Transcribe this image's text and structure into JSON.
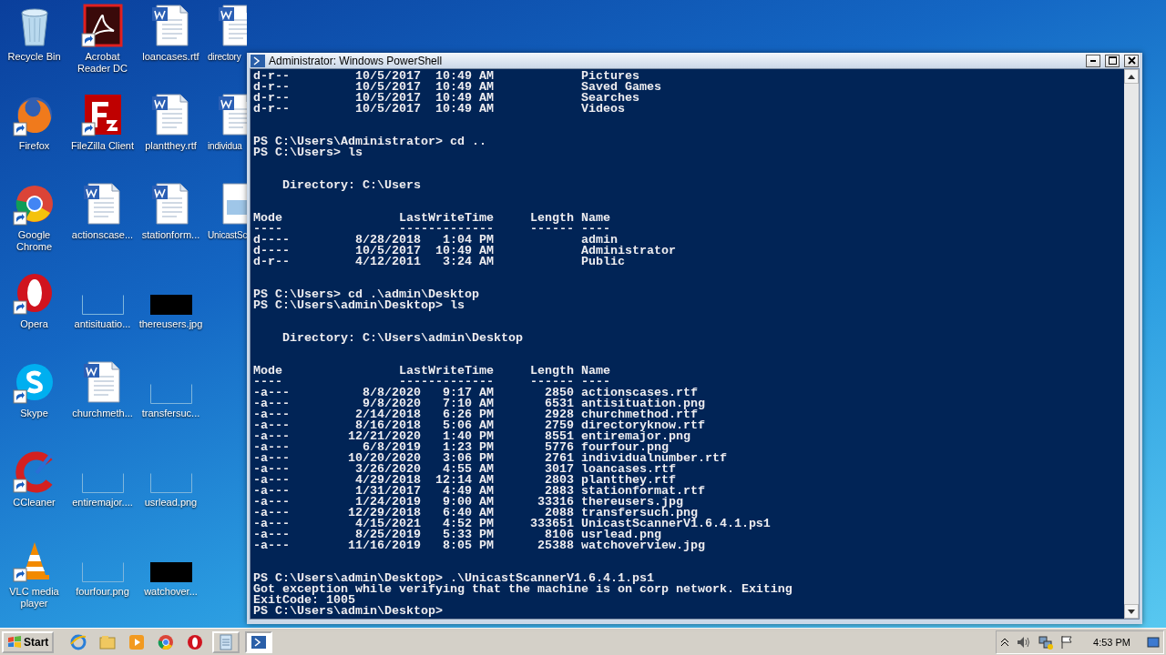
{
  "desktop_icons": [
    {
      "label": "Recycle Bin",
      "kind": "recycle",
      "shortcut": false
    },
    {
      "label": "Firefox",
      "kind": "firefox",
      "shortcut": true
    },
    {
      "label": "Google Chrome",
      "kind": "chrome",
      "shortcut": true
    },
    {
      "label": "Opera",
      "kind": "opera",
      "shortcut": true
    },
    {
      "label": "Skype",
      "kind": "skype",
      "shortcut": true
    },
    {
      "label": "CCleaner",
      "kind": "ccleaner",
      "shortcut": true
    },
    {
      "label": "VLC media player",
      "kind": "vlc",
      "shortcut": true
    },
    {
      "label": "Acrobat Reader DC",
      "kind": "acrobat",
      "shortcut": true
    },
    {
      "label": "FileZilla Client",
      "kind": "filezilla",
      "shortcut": true
    },
    {
      "label": "actionscase...",
      "kind": "document",
      "shortcut": false
    },
    {
      "label": "antisituatio...",
      "kind": "image-blank",
      "shortcut": false
    },
    {
      "label": "churchmeth...",
      "kind": "document",
      "shortcut": false
    },
    {
      "label": "entiremajor....",
      "kind": "image-blank",
      "shortcut": false
    },
    {
      "label": "fourfour.png",
      "kind": "image-blank",
      "shortcut": false
    },
    {
      "label": "loancases.rtf",
      "kind": "document",
      "shortcut": false
    },
    {
      "label": "plantthey.rtf",
      "kind": "document",
      "shortcut": false
    },
    {
      "label": "stationform...",
      "kind": "document",
      "shortcut": false
    },
    {
      "label": "thereusers.jpg",
      "kind": "image-dark",
      "shortcut": false
    },
    {
      "label": "transfersuc...",
      "kind": "image-blank",
      "shortcut": false
    },
    {
      "label": "usrlead.png",
      "kind": "image-blank",
      "shortcut": false
    },
    {
      "label": "watchover...",
      "kind": "image-dark",
      "shortcut": false
    },
    {
      "label": "directory",
      "kind": "document",
      "shortcut": false
    },
    {
      "label": "individua",
      "kind": "document",
      "shortcut": false
    },
    {
      "label": "UnicastSc",
      "kind": "script",
      "shortcut": false
    }
  ],
  "window": {
    "title": "Administrator: Windows PowerShell",
    "console_lines": [
      {
        "kind": "text",
        "text": "d-r--         10/5/2017  10:49 AM            Pictures"
      },
      {
        "kind": "text",
        "text": "d-r--         10/5/2017  10:49 AM            Saved Games"
      },
      {
        "kind": "text",
        "text": "d-r--         10/5/2017  10:49 AM            Searches"
      },
      {
        "kind": "text",
        "text": "d-r--         10/5/2017  10:49 AM            Videos"
      },
      {
        "kind": "blank"
      },
      {
        "kind": "blank"
      },
      {
        "kind": "text",
        "text": "PS C:\\Users\\Administrator> cd .."
      },
      {
        "kind": "text",
        "text": "PS C:\\Users> ls"
      },
      {
        "kind": "blank"
      },
      {
        "kind": "blank"
      },
      {
        "kind": "text",
        "text": "    Directory: C:\\Users"
      },
      {
        "kind": "blank"
      },
      {
        "kind": "blank"
      },
      {
        "kind": "text",
        "text": "Mode                LastWriteTime     Length Name"
      },
      {
        "kind": "text",
        "text": "----                -------------     ------ ----"
      },
      {
        "kind": "text",
        "text": "d----         8/28/2018   1:04 PM            admin"
      },
      {
        "kind": "text",
        "text": "d----         10/5/2017  10:49 AM            Administrator"
      },
      {
        "kind": "text",
        "text": "d-r--         4/12/2011   3:24 AM            Public"
      },
      {
        "kind": "blank"
      },
      {
        "kind": "blank"
      },
      {
        "kind": "text",
        "text": "PS C:\\Users> cd .\\admin\\Desktop"
      },
      {
        "kind": "text",
        "text": "PS C:\\Users\\admin\\Desktop> ls"
      },
      {
        "kind": "blank"
      },
      {
        "kind": "blank"
      },
      {
        "kind": "text",
        "text": "    Directory: C:\\Users\\admin\\Desktop"
      },
      {
        "kind": "blank"
      },
      {
        "kind": "blank"
      },
      {
        "kind": "text",
        "text": "Mode                LastWriteTime     Length Name"
      },
      {
        "kind": "text",
        "text": "----                -------------     ------ ----"
      },
      {
        "kind": "text",
        "text": "-a---          8/8/2020   9:17 AM       2850 actionscases.rtf"
      },
      {
        "kind": "text",
        "text": "-a---          9/8/2020   7:10 AM       6531 antisituation.png"
      },
      {
        "kind": "text",
        "text": "-a---         2/14/2018   6:26 PM       2928 churchmethod.rtf"
      },
      {
        "kind": "text",
        "text": "-a---         8/16/2018   5:06 AM       2759 directoryknow.rtf"
      },
      {
        "kind": "text",
        "text": "-a---        12/21/2020   1:40 PM       8551 entiremajor.png"
      },
      {
        "kind": "text",
        "text": "-a---          6/8/2019   1:23 PM       5776 fourfour.png"
      },
      {
        "kind": "text",
        "text": "-a---        10/20/2020   3:06 PM       2761 individualnumber.rtf"
      },
      {
        "kind": "text",
        "text": "-a---         3/26/2020   4:55 AM       3017 loancases.rtf"
      },
      {
        "kind": "text",
        "text": "-a---         4/29/2018  12:14 AM       2803 plantthey.rtf"
      },
      {
        "kind": "text",
        "text": "-a---         1/31/2017   4:49 AM       2883 stationformat.rtf"
      },
      {
        "kind": "text",
        "text": "-a---         1/24/2019   9:00 AM      33316 thereusers.jpg"
      },
      {
        "kind": "text",
        "text": "-a---        12/29/2018   6:40 AM       2088 transfersuch.png"
      },
      {
        "kind": "text",
        "text": "-a---         4/15/2021   4:52 PM     333651 UnicastScannerV1.6.4.1.ps1"
      },
      {
        "kind": "text",
        "text": "-a---         8/25/2019   5:33 PM       8106 usrlead.png"
      },
      {
        "kind": "text",
        "text": "-a---        11/16/2019   8:05 PM      25388 watchoverview.jpg"
      },
      {
        "kind": "blank"
      },
      {
        "kind": "blank"
      },
      {
        "kind": "text",
        "text": "PS C:\\Users\\admin\\Desktop> .\\UnicastScannerV1.6.4.1.ps1"
      },
      {
        "kind": "text",
        "text": "Got exception while verifying that the machine is on corp network. Exiting"
      },
      {
        "kind": "text",
        "text": "ExitCode: 1005"
      },
      {
        "kind": "text",
        "text": "PS C:\\Users\\admin\\Desktop>"
      }
    ]
  },
  "taskbar": {
    "start_label": "Start",
    "items": [
      {
        "kind": "ie",
        "open": false,
        "selected": false
      },
      {
        "kind": "explorer",
        "open": false,
        "selected": false
      },
      {
        "kind": "media",
        "open": false,
        "selected": false
      },
      {
        "kind": "chrome",
        "open": false,
        "selected": false
      },
      {
        "kind": "opera",
        "open": false,
        "selected": false
      },
      {
        "kind": "notepad",
        "open": true,
        "selected": false
      },
      {
        "kind": "powershell",
        "open": true,
        "selected": true
      }
    ],
    "clock": "4:53 PM"
  }
}
